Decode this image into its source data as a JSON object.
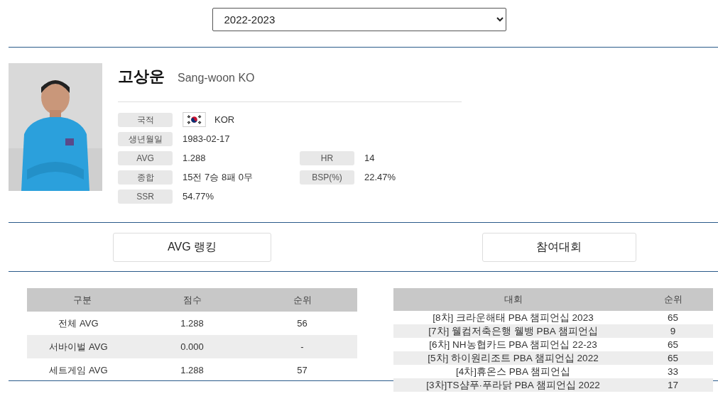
{
  "season_select": {
    "value": "2022-2023"
  },
  "player": {
    "name_ko": "고상운",
    "name_en": "Sang-woon KO",
    "info": [
      {
        "label": "국적",
        "value": "KOR",
        "flag": true
      },
      {
        "label": "생년월일",
        "value": "1983-02-17"
      },
      {
        "label": "AVG",
        "value": "1.288",
        "label2": "HR",
        "value2": "14"
      },
      {
        "label": "종합",
        "value": "15전 7승 8패 0무",
        "label2": "BSP(%)",
        "value2": "22.47%"
      },
      {
        "label": "SSR",
        "value": "54.77%"
      }
    ]
  },
  "sections": [
    {
      "title": "AVG 랭킹"
    },
    {
      "title": "참여대회"
    }
  ],
  "avg_table": {
    "columns": [
      "구분",
      "점수",
      "순위"
    ],
    "rows": [
      [
        "전체 AVG",
        "1.288",
        "56"
      ],
      [
        "서바이벌 AVG",
        "0.000",
        "-"
      ],
      [
        "세트게임 AVG",
        "1.288",
        "57"
      ]
    ]
  },
  "tournament_table": {
    "columns": [
      "대회",
      "순위"
    ],
    "rows": [
      [
        "[8차] 크라운해태 PBA 챔피언십 2023",
        "65"
      ],
      [
        "[7차] 웰컴저축은행 웰뱅 PBA 챔피언십",
        "9"
      ],
      [
        "[6차] NH농협카드 PBA 챔피언십 22-23",
        "65"
      ],
      [
        "[5차] 하이원리조트 PBA 챔피언십 2022",
        "65"
      ],
      [
        "[4차]휴온스 PBA 챔피언십",
        "33"
      ],
      [
        "[3차]TS샴푸·푸라닭 PBA 챔피언십 2022",
        "17"
      ]
    ]
  }
}
